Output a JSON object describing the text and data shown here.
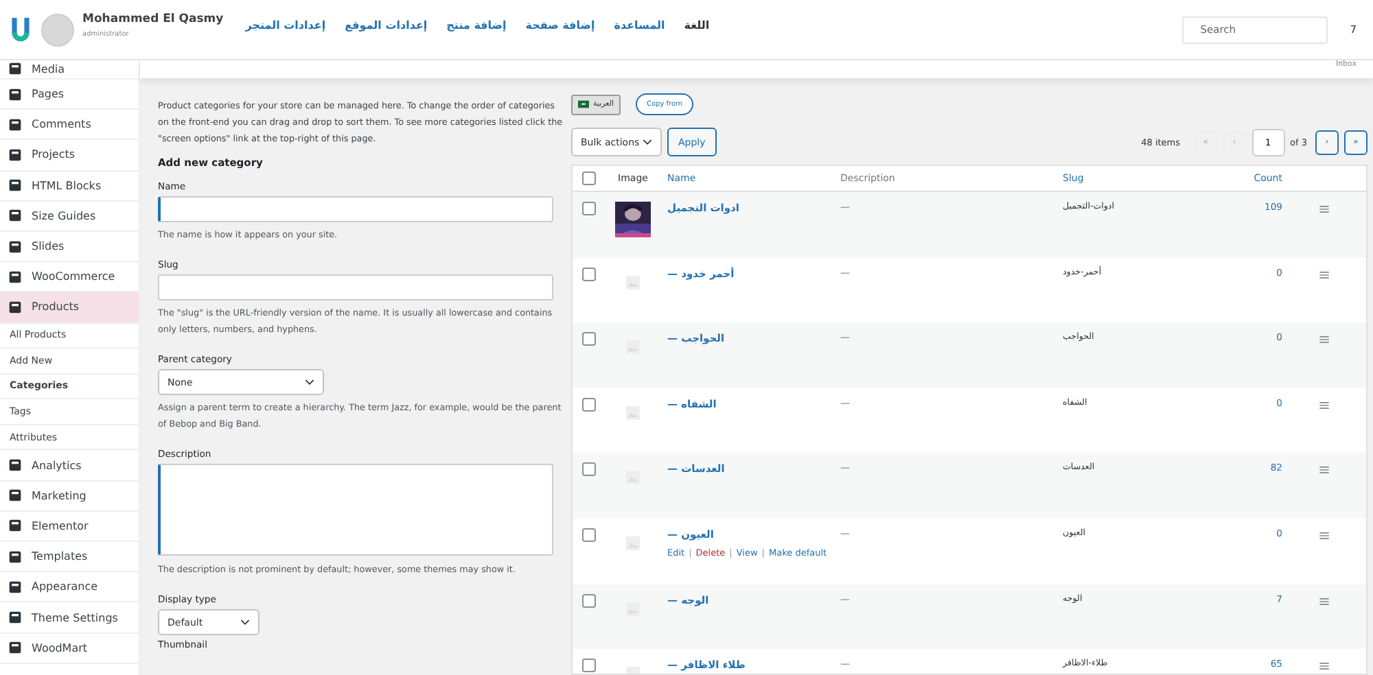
{
  "header": {
    "user_name": "Mohammed El Qasmy",
    "user_role": "administrator",
    "links": [
      {
        "label": "اللغة",
        "kind": "plain"
      },
      {
        "label": "المساعدة",
        "kind": "link"
      },
      {
        "label": "إضافة صفحة",
        "kind": "link"
      },
      {
        "label": "إضافة منتج",
        "kind": "link"
      },
      {
        "label": "إعدادات الموقع",
        "kind": "link"
      },
      {
        "label": "إعدادات المتجر",
        "kind": "link"
      }
    ],
    "search": {
      "placeholder": "Search"
    },
    "count": "7",
    "inbox": "Inbox"
  },
  "sidebar": {
    "items": [
      {
        "label": "Media",
        "kind": "main",
        "selected": false
      },
      {
        "label": "Pages",
        "kind": "main",
        "selected": false
      },
      {
        "label": "Comments",
        "kind": "main",
        "selected": false
      },
      {
        "label": "Projects",
        "kind": "main",
        "selected": false
      },
      {
        "label": "HTML Blocks",
        "kind": "main",
        "selected": false
      },
      {
        "label": "Size Guides",
        "kind": "main",
        "selected": false
      },
      {
        "label": "Slides",
        "kind": "main",
        "selected": false
      },
      {
        "label": "WooCommerce",
        "kind": "main",
        "selected": false
      },
      {
        "label": "Products",
        "kind": "main",
        "selected": true
      },
      {
        "label": "All Products",
        "kind": "sub",
        "selected": false
      },
      {
        "label": "Add New",
        "kind": "sub",
        "selected": false
      },
      {
        "label": "Categories",
        "kind": "sub",
        "selected": true
      },
      {
        "label": "Tags",
        "kind": "sub",
        "selected": false
      },
      {
        "label": "Attributes",
        "kind": "sub",
        "selected": false
      },
      {
        "label": "Analytics",
        "kind": "main",
        "selected": false
      },
      {
        "label": "Marketing",
        "kind": "main",
        "selected": false
      },
      {
        "label": "Elementor",
        "kind": "main",
        "selected": false
      },
      {
        "label": "Templates",
        "kind": "main",
        "selected": false
      },
      {
        "label": "Appearance",
        "kind": "main",
        "selected": false
      },
      {
        "label": "Theme Settings",
        "kind": "main",
        "selected": false
      },
      {
        "label": "WoodMart",
        "kind": "main",
        "selected": false
      }
    ]
  },
  "form": {
    "intro": "Product categories for your store can be managed here. To change the order of categories on the front-end you can drag and drop to sort them. To see more categories listed click the \"screen options\" link at the top-right of this page.",
    "heading": "Add new category",
    "fields": [
      {
        "label": "Name",
        "kind": "text",
        "help": "The name is how it appears on your site."
      },
      {
        "label": "Slug",
        "kind": "text",
        "help": "The \"slug\" is the URL-friendly version of the name. It is usually all lowercase and contains only letters, numbers, and hyphens."
      },
      {
        "label": "Parent category",
        "kind": "select",
        "value": "None",
        "help": "Assign a parent term to create a hierarchy. The term Jazz, for example, would be the parent of Bebop and Big Band."
      },
      {
        "label": "Description",
        "kind": "textarea",
        "help": "The description is not prominent by default; however, some themes may show it."
      },
      {
        "label": "Display type",
        "kind": "select",
        "value": "Default"
      },
      {
        "label": "Thumbnail",
        "kind": "label"
      }
    ]
  },
  "language": {
    "current": "العربية",
    "copy": "Copy from"
  },
  "toolbar": {
    "bulk": "Bulk actions",
    "apply": "Apply",
    "items": "48 items",
    "page": "1",
    "of": "of 3",
    "pager": [
      {
        "label": "«",
        "disabled": true
      },
      {
        "label": "‹",
        "disabled": true
      },
      {
        "label": "›",
        "disabled": false
      },
      {
        "label": "»",
        "disabled": false
      }
    ]
  },
  "table": {
    "select_all_checked": false,
    "action_separator": "|",
    "columns": [
      "Image",
      "Name",
      "Description",
      "Slug",
      "Count"
    ],
    "rows": [
      {
        "kind": "picture",
        "checked": false,
        "name": "ادوات التجميل",
        "description": "—",
        "slug": "ادوات-التجميل",
        "count": "109"
      },
      {
        "kind": "placeholder",
        "checked": false,
        "name": "— أحمر خدود",
        "description": "—",
        "slug": "أحمر-خدود",
        "count": "0"
      },
      {
        "kind": "placeholder",
        "checked": false,
        "name": "— الحواجب",
        "description": "—",
        "slug": "الحواجب",
        "count": "0"
      },
      {
        "kind": "placeholder",
        "checked": false,
        "name": "— الشفاه",
        "description": "—",
        "slug": "الشفاه",
        "count": "0"
      },
      {
        "kind": "placeholder",
        "checked": false,
        "name": "— العدسات",
        "description": "—",
        "slug": "العدسات",
        "count": "82"
      },
      {
        "kind": "placeholder",
        "checked": false,
        "name": "— العيون",
        "description": "—",
        "slug": "العيون",
        "count": "0",
        "actions": [
          {
            "label": "Edit",
            "kind": "normal"
          },
          {
            "label": "Delete",
            "kind": "danger"
          },
          {
            "label": "View",
            "kind": "normal"
          },
          {
            "label": "Make default",
            "kind": "normal"
          }
        ]
      },
      {
        "kind": "placeholder",
        "checked": false,
        "name": "— الوجه",
        "description": "—",
        "slug": "الوجه",
        "count": "7"
      },
      {
        "kind": "placeholder",
        "checked": false,
        "name": "— طلاء الاظافر",
        "description": "—",
        "slug": "طلاء-الاظافر",
        "count": "65"
      }
    ]
  }
}
